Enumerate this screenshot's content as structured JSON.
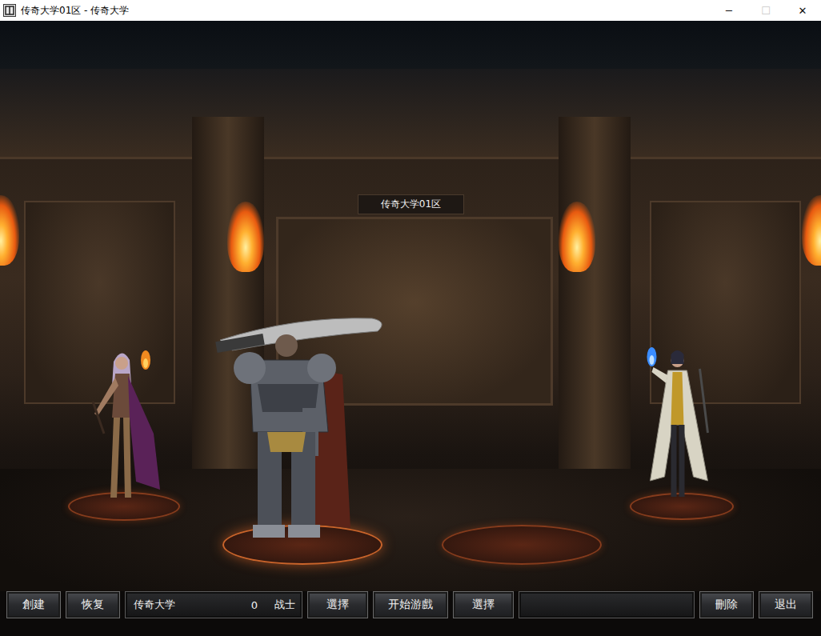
{
  "window": {
    "title": "传奇大学01区 - 传奇大学",
    "controls": [
      {
        "name": "minimize",
        "glyph": "─",
        "disabled": false
      },
      {
        "name": "maximize",
        "glyph": "☐",
        "disabled": true
      },
      {
        "name": "close",
        "glyph": "✕",
        "disabled": false
      }
    ]
  },
  "server": {
    "name": "传奇大学01区"
  },
  "slots": [
    {
      "kind": "sorceress",
      "selected": false
    },
    {
      "kind": "warrior",
      "selected": true
    },
    {
      "kind": "empty",
      "selected": false
    },
    {
      "kind": "mage",
      "selected": false
    }
  ],
  "toolbar": {
    "left_buttons": [
      "創建",
      "恢复"
    ],
    "character": {
      "name": "传奇大学",
      "level": "0",
      "class": "战士"
    },
    "mid_buttons": [
      "選擇",
      "开始游戲",
      "選擇"
    ],
    "right_buttons": [
      "刪除",
      "退出"
    ]
  }
}
